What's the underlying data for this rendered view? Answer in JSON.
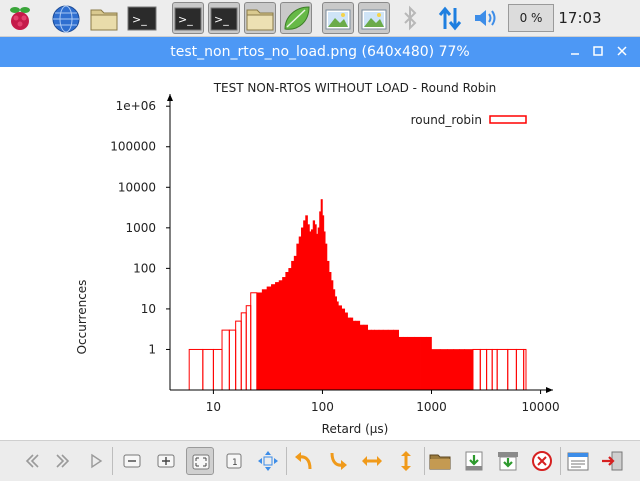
{
  "panel": {
    "cpu_text": "0 %",
    "clock": "17:03",
    "buttons": [
      {
        "name": "raspberry-menu-icon"
      },
      {
        "name": "web-browser-icon"
      },
      {
        "name": "file-manager-icon"
      },
      {
        "name": "terminal-icon"
      },
      {
        "name": "terminal-window-icon"
      },
      {
        "name": "terminal-window-2-icon"
      },
      {
        "name": "folder-window-icon"
      },
      {
        "name": "text-editor-window-icon"
      },
      {
        "name": "image-viewer-window-icon"
      },
      {
        "name": "image-viewer-window-2-icon"
      }
    ]
  },
  "window": {
    "title": "test_non_rtos_no_load.png (640x480) 77%"
  },
  "chart_data": {
    "type": "bar",
    "title": "TEST NON-RTOS WITHOUT LOAD - Round Robin",
    "xlabel": "Retard (µs)",
    "ylabel": "Occurrences",
    "x_scale": "log",
    "y_scale": "log",
    "xlim": [
      4,
      13000
    ],
    "ylim": [
      0.1,
      2000000
    ],
    "x_ticks": [
      "10",
      "100",
      "1000",
      "10000"
    ],
    "y_ticks": [
      "1",
      "10",
      "100",
      "1000",
      "10000",
      "100000",
      "1e+06"
    ],
    "series": [
      {
        "name": "round_robin",
        "color": "#ff0000",
        "x": [
          6,
          8,
          10,
          12,
          14,
          16,
          18,
          20,
          22,
          25,
          28,
          31,
          34,
          37,
          40,
          43,
          46,
          49,
          52,
          55,
          58,
          61,
          64,
          67,
          70,
          73,
          76,
          79,
          82,
          85,
          88,
          91,
          94,
          97,
          100,
          103,
          106,
          110,
          115,
          120,
          125,
          130,
          135,
          140,
          150,
          160,
          170,
          180,
          190,
          200,
          220,
          240,
          260,
          280,
          300,
          330,
          360,
          400,
          450,
          500,
          550,
          600,
          700,
          800,
          900,
          1000,
          1200,
          1400,
          1600,
          1800,
          2000,
          2400,
          2800,
          3200,
          3600,
          4000,
          5000,
          6000,
          7000
        ],
        "values": [
          1,
          1,
          1,
          3,
          3,
          5,
          8,
          12,
          25,
          25,
          30,
          35,
          40,
          45,
          50,
          60,
          80,
          100,
          150,
          200,
          400,
          600,
          1000,
          1500,
          2000,
          1200,
          800,
          900,
          1500,
          1200,
          700,
          1000,
          2500,
          5000,
          2000,
          800,
          400,
          150,
          80,
          50,
          30,
          20,
          15,
          12,
          10,
          8,
          6,
          6,
          5,
          5,
          4,
          4,
          3,
          3,
          3,
          3,
          3,
          3,
          3,
          2,
          2,
          2,
          2,
          2,
          2,
          1,
          1,
          1,
          1,
          1,
          1,
          1,
          1,
          1,
          1,
          1,
          1,
          1,
          1
        ]
      }
    ]
  },
  "toolbar": {
    "buttons": [
      {
        "name": "previous-icon"
      },
      {
        "name": "next-icon"
      },
      {
        "name": "slideshow-play-icon"
      },
      {
        "name": "zoom-out-icon"
      },
      {
        "name": "zoom-in-icon"
      },
      {
        "name": "fit-to-window-icon"
      },
      {
        "name": "original-size-icon"
      },
      {
        "name": "fullscreen-icon"
      },
      {
        "name": "rotate-left-icon"
      },
      {
        "name": "rotate-right-icon"
      },
      {
        "name": "flip-horizontal-icon"
      },
      {
        "name": "flip-vertical-icon"
      },
      {
        "name": "open-file-icon"
      },
      {
        "name": "save-file-icon"
      },
      {
        "name": "save-as-icon"
      },
      {
        "name": "delete-icon"
      },
      {
        "name": "preferences-icon"
      },
      {
        "name": "quit-icon"
      }
    ]
  }
}
